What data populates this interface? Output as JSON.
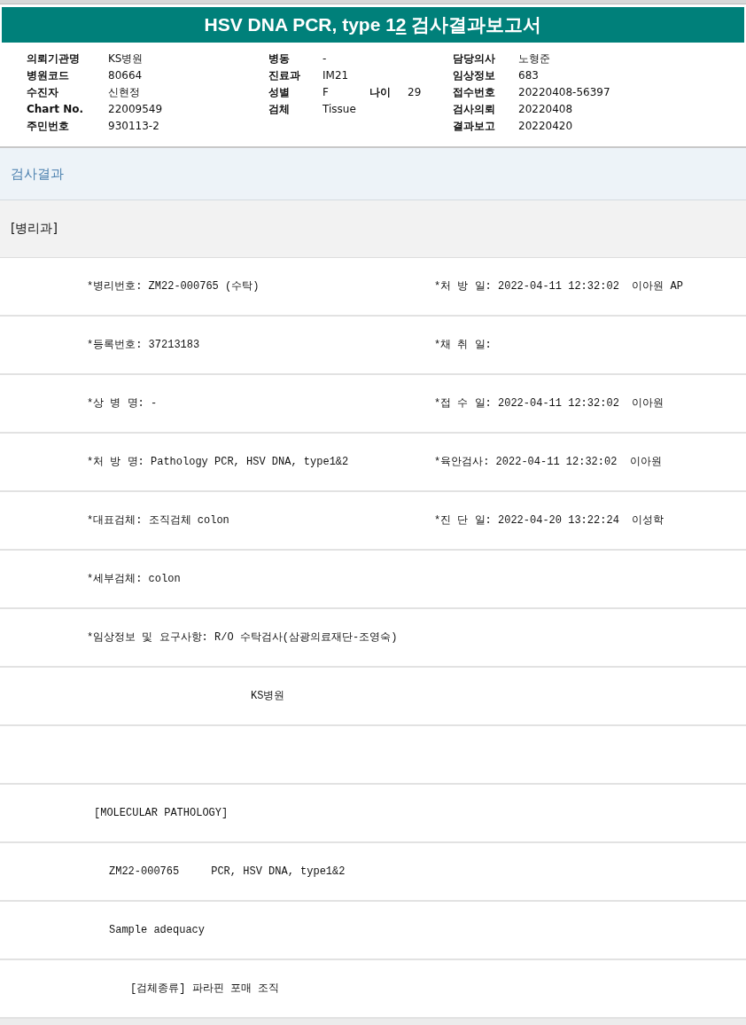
{
  "title": [
    {
      "text": "HSV DNA PCR, type 1",
      "underlined": false
    },
    {
      "text": "2",
      "underlined": true
    },
    {
      "text": " 검사결과보고서",
      "underlined": false
    }
  ],
  "header": {
    "columns": [
      [
        {
          "label": "의뢰기관명",
          "value": "KS병원"
        },
        {
          "label": "병원코드",
          "value": "80664"
        },
        {
          "label": "수진자",
          "value": "신현정"
        },
        {
          "label": "Chart No.",
          "value": "22009549"
        },
        {
          "label": "주민번호",
          "value": "930113-2"
        }
      ],
      [
        {
          "label": "병동",
          "value": "-"
        },
        {
          "label": "진료과",
          "value": "IM21"
        },
        {
          "label": "성별",
          "value": "F",
          "extra": {
            "label": "나이",
            "value": "29"
          }
        },
        {
          "label": "검체",
          "value": "Tissue"
        }
      ],
      [
        {
          "label": "담당의사",
          "value": "노형준"
        },
        {
          "label": "임상정보",
          "value": "683"
        },
        {
          "label": "접수번호",
          "value": "20220408-56397"
        },
        {
          "label": "검사의뢰",
          "value": "20220408"
        },
        {
          "label": "결과보고",
          "value": "20220420"
        }
      ]
    ]
  },
  "section_title": "검사결과",
  "department": "[병리과]",
  "rows": [
    {
      "kind": "field",
      "cells": [
        "*병리번호: ZM22-000765 (수탁)",
        "*처 방 일: 2022-04-11 12:32:02  이아원 AP"
      ]
    },
    {
      "kind": "field",
      "cells": [
        "*등록번호: 37213183",
        "*채 취 일:"
      ]
    },
    {
      "kind": "field",
      "cells": [
        "*상 병 명: -",
        "*접 수 일: 2022-04-11 12:32:02  이아원"
      ]
    },
    {
      "kind": "field",
      "cells": [
        "*처 방 명: Pathology PCR, HSV DNA, type1&2",
        "*육안검사: 2022-04-11 12:32:02  이아원"
      ]
    },
    {
      "kind": "field",
      "cells": [
        "*대표검체: 조직검체 colon",
        "*진 단 일: 2022-04-20 13:22:24  이성학"
      ]
    },
    {
      "kind": "field",
      "cells": [
        "*세부검체: colon"
      ]
    },
    {
      "kind": "field",
      "cells": [
        "*임상정보 및 요구사항: R/O 수탁검사(삼광의료재단-조영숙)"
      ]
    },
    {
      "kind": "signature",
      "cells": [
        "KS병원"
      ]
    },
    {
      "kind": "blank",
      "cells": []
    },
    {
      "kind": "heading",
      "cells": [
        "[MOLECULAR PATHOLOGY]"
      ]
    },
    {
      "kind": "item",
      "cells": [
        "ZM22-000765     PCR, HSV DNA, type1&2"
      ]
    },
    {
      "kind": "item",
      "cells": [
        "Sample adequacy"
      ]
    },
    {
      "kind": "subitem",
      "cells": [
        "[검체종류] 파라핀 포매 조직"
      ]
    }
  ]
}
